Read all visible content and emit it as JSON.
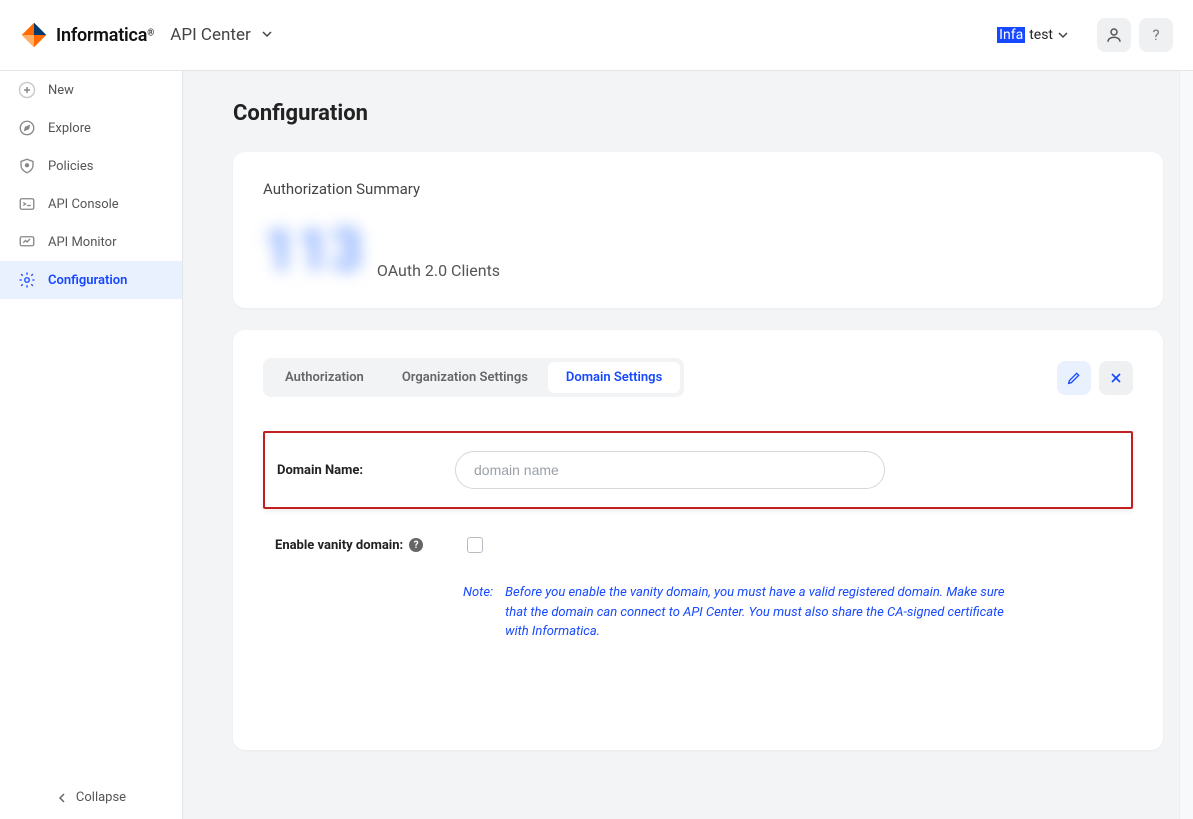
{
  "header": {
    "brand": "Informatica",
    "product": "API Center",
    "tenant_highlight": "Infa",
    "tenant_rest": "test"
  },
  "sidebar": {
    "items": [
      {
        "label": "New"
      },
      {
        "label": "Explore"
      },
      {
        "label": "Policies"
      },
      {
        "label": "API Console"
      },
      {
        "label": "API Monitor"
      },
      {
        "label": "Configuration"
      }
    ],
    "collapse": "Collapse"
  },
  "page": {
    "title": "Configuration"
  },
  "summary": {
    "title": "Authorization Summary",
    "blur_value": "113",
    "stat_label": "OAuth 2.0 Clients"
  },
  "tabs": {
    "items": [
      "Authorization",
      "Organization Settings",
      "Domain Settings"
    ],
    "active": 2
  },
  "form": {
    "domain_label": "Domain Name:",
    "domain_placeholder": "domain name",
    "vanity_label": "Enable vanity domain:",
    "note_label": "Note:",
    "note_text": "Before you enable the vanity domain, you must have a valid registered domain. Make sure that the domain can connect to API Center. You must also share the CA-signed certificate with Informatica."
  }
}
